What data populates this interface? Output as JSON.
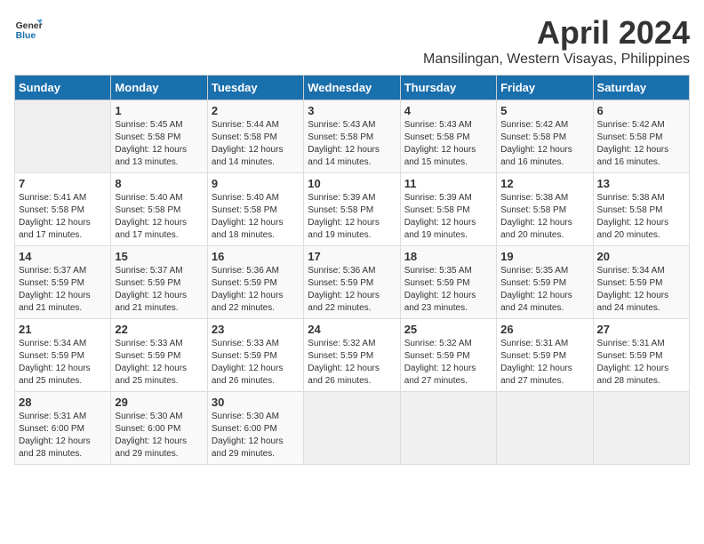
{
  "header": {
    "logo_general": "General",
    "logo_blue": "Blue",
    "month_title": "April 2024",
    "location": "Mansilingan, Western Visayas, Philippines"
  },
  "calendar": {
    "days_of_week": [
      "Sunday",
      "Monday",
      "Tuesday",
      "Wednesday",
      "Thursday",
      "Friday",
      "Saturday"
    ],
    "weeks": [
      [
        {
          "day": "",
          "sunrise": "",
          "sunset": "",
          "daylight": ""
        },
        {
          "day": "1",
          "sunrise": "Sunrise: 5:45 AM",
          "sunset": "Sunset: 5:58 PM",
          "daylight": "Daylight: 12 hours and 13 minutes."
        },
        {
          "day": "2",
          "sunrise": "Sunrise: 5:44 AM",
          "sunset": "Sunset: 5:58 PM",
          "daylight": "Daylight: 12 hours and 14 minutes."
        },
        {
          "day": "3",
          "sunrise": "Sunrise: 5:43 AM",
          "sunset": "Sunset: 5:58 PM",
          "daylight": "Daylight: 12 hours and 14 minutes."
        },
        {
          "day": "4",
          "sunrise": "Sunrise: 5:43 AM",
          "sunset": "Sunset: 5:58 PM",
          "daylight": "Daylight: 12 hours and 15 minutes."
        },
        {
          "day": "5",
          "sunrise": "Sunrise: 5:42 AM",
          "sunset": "Sunset: 5:58 PM",
          "daylight": "Daylight: 12 hours and 16 minutes."
        },
        {
          "day": "6",
          "sunrise": "Sunrise: 5:42 AM",
          "sunset": "Sunset: 5:58 PM",
          "daylight": "Daylight: 12 hours and 16 minutes."
        }
      ],
      [
        {
          "day": "7",
          "sunrise": "Sunrise: 5:41 AM",
          "sunset": "Sunset: 5:58 PM",
          "daylight": "Daylight: 12 hours and 17 minutes."
        },
        {
          "day": "8",
          "sunrise": "Sunrise: 5:40 AM",
          "sunset": "Sunset: 5:58 PM",
          "daylight": "Daylight: 12 hours and 17 minutes."
        },
        {
          "day": "9",
          "sunrise": "Sunrise: 5:40 AM",
          "sunset": "Sunset: 5:58 PM",
          "daylight": "Daylight: 12 hours and 18 minutes."
        },
        {
          "day": "10",
          "sunrise": "Sunrise: 5:39 AM",
          "sunset": "Sunset: 5:58 PM",
          "daylight": "Daylight: 12 hours and 19 minutes."
        },
        {
          "day": "11",
          "sunrise": "Sunrise: 5:39 AM",
          "sunset": "Sunset: 5:58 PM",
          "daylight": "Daylight: 12 hours and 19 minutes."
        },
        {
          "day": "12",
          "sunrise": "Sunrise: 5:38 AM",
          "sunset": "Sunset: 5:58 PM",
          "daylight": "Daylight: 12 hours and 20 minutes."
        },
        {
          "day": "13",
          "sunrise": "Sunrise: 5:38 AM",
          "sunset": "Sunset: 5:58 PM",
          "daylight": "Daylight: 12 hours and 20 minutes."
        }
      ],
      [
        {
          "day": "14",
          "sunrise": "Sunrise: 5:37 AM",
          "sunset": "Sunset: 5:59 PM",
          "daylight": "Daylight: 12 hours and 21 minutes."
        },
        {
          "day": "15",
          "sunrise": "Sunrise: 5:37 AM",
          "sunset": "Sunset: 5:59 PM",
          "daylight": "Daylight: 12 hours and 21 minutes."
        },
        {
          "day": "16",
          "sunrise": "Sunrise: 5:36 AM",
          "sunset": "Sunset: 5:59 PM",
          "daylight": "Daylight: 12 hours and 22 minutes."
        },
        {
          "day": "17",
          "sunrise": "Sunrise: 5:36 AM",
          "sunset": "Sunset: 5:59 PM",
          "daylight": "Daylight: 12 hours and 22 minutes."
        },
        {
          "day": "18",
          "sunrise": "Sunrise: 5:35 AM",
          "sunset": "Sunset: 5:59 PM",
          "daylight": "Daylight: 12 hours and 23 minutes."
        },
        {
          "day": "19",
          "sunrise": "Sunrise: 5:35 AM",
          "sunset": "Sunset: 5:59 PM",
          "daylight": "Daylight: 12 hours and 24 minutes."
        },
        {
          "day": "20",
          "sunrise": "Sunrise: 5:34 AM",
          "sunset": "Sunset: 5:59 PM",
          "daylight": "Daylight: 12 hours and 24 minutes."
        }
      ],
      [
        {
          "day": "21",
          "sunrise": "Sunrise: 5:34 AM",
          "sunset": "Sunset: 5:59 PM",
          "daylight": "Daylight: 12 hours and 25 minutes."
        },
        {
          "day": "22",
          "sunrise": "Sunrise: 5:33 AM",
          "sunset": "Sunset: 5:59 PM",
          "daylight": "Daylight: 12 hours and 25 minutes."
        },
        {
          "day": "23",
          "sunrise": "Sunrise: 5:33 AM",
          "sunset": "Sunset: 5:59 PM",
          "daylight": "Daylight: 12 hours and 26 minutes."
        },
        {
          "day": "24",
          "sunrise": "Sunrise: 5:32 AM",
          "sunset": "Sunset: 5:59 PM",
          "daylight": "Daylight: 12 hours and 26 minutes."
        },
        {
          "day": "25",
          "sunrise": "Sunrise: 5:32 AM",
          "sunset": "Sunset: 5:59 PM",
          "daylight": "Daylight: 12 hours and 27 minutes."
        },
        {
          "day": "26",
          "sunrise": "Sunrise: 5:31 AM",
          "sunset": "Sunset: 5:59 PM",
          "daylight": "Daylight: 12 hours and 27 minutes."
        },
        {
          "day": "27",
          "sunrise": "Sunrise: 5:31 AM",
          "sunset": "Sunset: 5:59 PM",
          "daylight": "Daylight: 12 hours and 28 minutes."
        }
      ],
      [
        {
          "day": "28",
          "sunrise": "Sunrise: 5:31 AM",
          "sunset": "Sunset: 6:00 PM",
          "daylight": "Daylight: 12 hours and 28 minutes."
        },
        {
          "day": "29",
          "sunrise": "Sunrise: 5:30 AM",
          "sunset": "Sunset: 6:00 PM",
          "daylight": "Daylight: 12 hours and 29 minutes."
        },
        {
          "day": "30",
          "sunrise": "Sunrise: 5:30 AM",
          "sunset": "Sunset: 6:00 PM",
          "daylight": "Daylight: 12 hours and 29 minutes."
        },
        {
          "day": "",
          "sunrise": "",
          "sunset": "",
          "daylight": ""
        },
        {
          "day": "",
          "sunrise": "",
          "sunset": "",
          "daylight": ""
        },
        {
          "day": "",
          "sunrise": "",
          "sunset": "",
          "daylight": ""
        },
        {
          "day": "",
          "sunrise": "",
          "sunset": "",
          "daylight": ""
        }
      ]
    ]
  }
}
